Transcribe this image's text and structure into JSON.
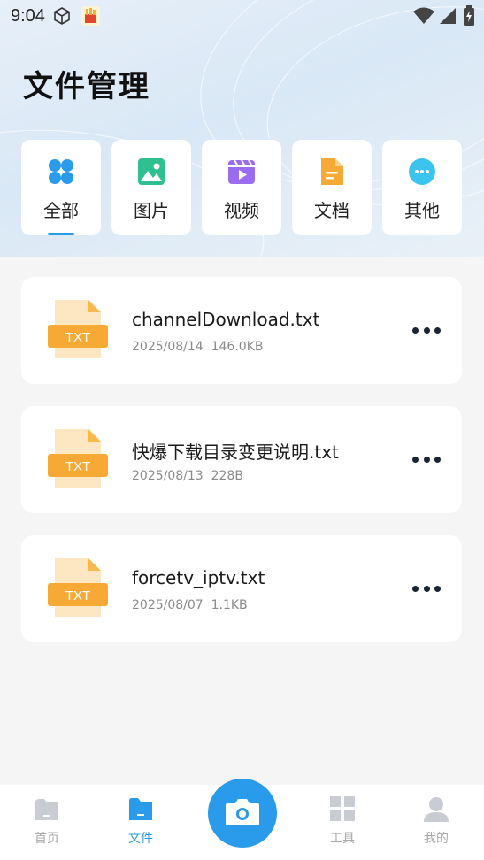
{
  "status_bar": {
    "time": "9:04"
  },
  "page_title": "文件管理",
  "categories": [
    {
      "label": "全部",
      "icon": "grid-all-icon",
      "active": true
    },
    {
      "label": "图片",
      "icon": "image-icon",
      "active": false
    },
    {
      "label": "视频",
      "icon": "video-icon",
      "active": false
    },
    {
      "label": "文档",
      "icon": "document-icon",
      "active": false
    },
    {
      "label": "其他",
      "icon": "more-dots-icon",
      "active": false
    }
  ],
  "files": [
    {
      "name": "channelDownload.txt",
      "date": "2025/08/14",
      "size": "146.0KB",
      "type_label": "TXT"
    },
    {
      "name": "快爆下载目录变更说明.txt",
      "date": "2025/08/13",
      "size": "228B",
      "type_label": "TXT"
    },
    {
      "name": "forcetv_iptv.txt",
      "date": "2025/08/07",
      "size": "1.1KB",
      "type_label": "TXT"
    }
  ],
  "tab_bar": {
    "home": "首页",
    "files": "文件",
    "tools": "工具",
    "mine": "我的"
  },
  "colors": {
    "accent": "#2a9bea",
    "txt_icon": "#f7a935",
    "image_icon": "#2fc08f",
    "video_icon": "#9b6cf0",
    "doc_icon": "#f7a935",
    "other_icon": "#3bc5ee"
  }
}
